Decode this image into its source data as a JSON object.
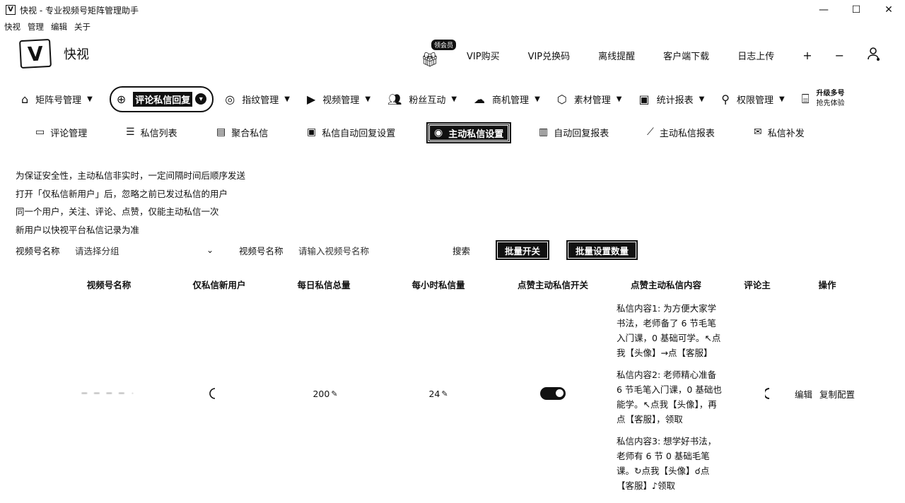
{
  "window": {
    "title": "快视 - 专业视频号矩阵管理助手",
    "icon_glyph": "V",
    "controls": {
      "minimize": "—",
      "maximize": "☐",
      "close": "✕"
    }
  },
  "menubar": [
    "快视",
    "管理",
    "编辑",
    "关于"
  ],
  "brand": {
    "logo": "V",
    "name": "快视"
  },
  "top_actions": {
    "gift_badge": "领会员",
    "items": [
      "VIP购买",
      "VIP兑换码",
      "离线提醒",
      "客户端下载",
      "日志上传"
    ],
    "plus": "+",
    "minus": "−"
  },
  "primary_nav": [
    {
      "label": "矩阵号管理",
      "icon": "home-icon"
    },
    {
      "label": "评论私信回复",
      "icon": "robot-icon",
      "active": true
    },
    {
      "label": "指纹管理",
      "icon": "fingerprint-icon"
    },
    {
      "label": "视频管理",
      "icon": "play-icon"
    },
    {
      "label": "粉丝互动",
      "icon": "users-icon"
    },
    {
      "label": "商机管理",
      "icon": "cloud-icon"
    },
    {
      "label": "素材管理",
      "icon": "box-icon"
    },
    {
      "label": "统计报表",
      "icon": "chart-icon"
    },
    {
      "label": "权限管理",
      "icon": "user-key-icon"
    }
  ],
  "upgrade": {
    "line1": "升级多号",
    "line2": "抢先体验"
  },
  "sub_nav": [
    {
      "label": "评论管理",
      "icon": "comment-icon"
    },
    {
      "label": "私信列表",
      "icon": "message-list-icon"
    },
    {
      "label": "聚合私信",
      "icon": "aggregate-icon"
    },
    {
      "label": "私信自动回复设置",
      "icon": "auto-reply-icon"
    },
    {
      "label": "主动私信设置",
      "icon": "user-circle-icon",
      "active": true
    },
    {
      "label": "自动回复报表",
      "icon": "bar-chart-icon"
    },
    {
      "label": "主动私信报表",
      "icon": "line-chart-icon"
    },
    {
      "label": "私信补发",
      "icon": "mail-resend-icon"
    }
  ],
  "notices": [
    "为保证安全性，主动私信非实时，一定间隔时间后顺序发送",
    "打开「仅私信新用户」后，忽略之前已发过私信的用户",
    "同一个用户，关注、评论、点赞，仅能主动私信一次",
    "新用户以快视平台私信记录为准"
  ],
  "filters": {
    "account_label": "视频号名称",
    "account_select_placeholder": "请选择分组",
    "name_label": "视频号名称",
    "name_input_placeholder": "请输入视频号名称",
    "search_label": "搜索",
    "batch_toggle": "批量开关",
    "batch_set_count": "批量设置数量"
  },
  "table": {
    "columns": [
      "视频号名称",
      "仅私信新用户",
      "每日私信总量",
      "每小时私信量",
      "点赞主动私信开关",
      "点赞主动私信内容",
      "评论主",
      "操作"
    ],
    "rows": [
      {
        "account_name": "━ ━ ━ ━ ·",
        "new_only_state": "loading",
        "daily_total": "200",
        "hourly": "24",
        "like_switch": "on",
        "messages": [
          "私信内容1: 为方便大家学书法，老师备了 6 节毛笔入门课，0 基础可学。↖点我【头像】→点【客服】",
          "私信内容2: 老师精心准备 6 节毛笔入门课，0 基础也能学。↖点我【头像】，再点【客服】，领取",
          "私信内容3: 想学好书法，老师有 6 节 0 基础毛笔课。↻点我【头像】☌点【客服】♪领取"
        ],
        "actions": [
          "编辑",
          "复制配置"
        ]
      }
    ]
  }
}
